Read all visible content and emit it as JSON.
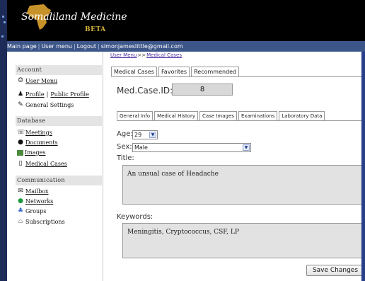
{
  "header": {
    "title": "Somaliland Medicine",
    "beta": "BETA"
  },
  "navbar": {
    "items": [
      "Main page",
      "User menu",
      "Logout"
    ],
    "user_email": "simonjameslittle@gmail.com"
  },
  "breadcrumb": {
    "parts": [
      "User Menu",
      ">>",
      "Medical Cases"
    ]
  },
  "sidebar": {
    "account": {
      "heading": "Account",
      "items": [
        "User Menu",
        "Profile",
        "|",
        "Public Profile",
        "General Settings"
      ]
    },
    "database": {
      "heading": "Database",
      "items": [
        "Meetings",
        "Documents",
        "Images",
        "Medical Cases"
      ]
    },
    "communication": {
      "heading": "Communication",
      "items": [
        "Mailbox",
        "Networks",
        "Groups",
        "Subscriptions"
      ]
    }
  },
  "main": {
    "tabs": [
      "Medical Cases",
      "Favorites",
      "Recommended"
    ],
    "case_id_label": "Med.Case.ID:",
    "case_id_value": "8",
    "inner_tabs": [
      "General Info",
      "Medical History",
      "Case Images",
      "Examinations",
      "Laboratory Data"
    ],
    "age_label": "Age:",
    "age_value": "29",
    "sex_label": "Sex:",
    "sex_value": "Male",
    "title_label": "Title:",
    "title_value": "An unsual case of Headache",
    "keywords_label": "Keywords:",
    "keywords_value": "Meningitis, Cryptococcus, CSF, LP",
    "save_label": "Save Changes"
  },
  "icons": {
    "dropdown": "chevron-down-icon"
  }
}
